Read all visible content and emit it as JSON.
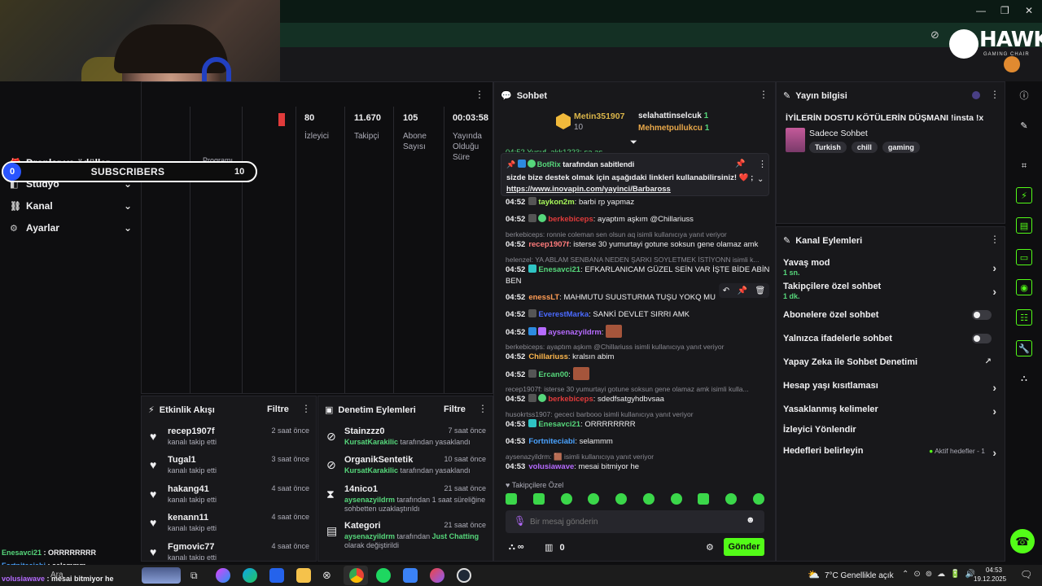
{
  "overlay": {
    "subscribers_current": "0",
    "subscribers_label": "SUBSCRIBERS",
    "subscribers_goal": "10",
    "brand_name": "HAWK",
    "brand_tagline": "GAMING CHAIR",
    "chat_overlay": [
      {
        "user": "Enesavci21",
        "msg": " : ORRRRRRRR",
        "color": "#56d77b"
      },
      {
        "user": "Fortniteciabi",
        "msg": " : selammm",
        "color": "#4aa3ff"
      },
      {
        "user": "volusiawave",
        "msg": " : mesai bitmiyor he",
        "color": "#b66bff"
      }
    ]
  },
  "leftnav": {
    "items": [
      {
        "label": "Droplar ve ödüller",
        "icon": "gift-icon"
      },
      {
        "label": "Stüdyo",
        "icon": "studio-icon"
      },
      {
        "label": "Kanal",
        "icon": "channel-icon"
      },
      {
        "label": "Ayarlar",
        "icon": "gear-icon"
      }
    ],
    "program_label": "Programı"
  },
  "stats": {
    "items": [
      {
        "value": "80",
        "label": "İzleyici"
      },
      {
        "value": "11.670",
        "label": "Takipçi"
      },
      {
        "value": "105",
        "label": "Abone Sayısı"
      },
      {
        "value": "00:03:58",
        "label": "Yayında Olduğu Süre"
      }
    ]
  },
  "activity": {
    "title": "Etkinlik Akışı",
    "filter": "Filtre",
    "rows": [
      {
        "name": "recep1907f",
        "sub": "kanalı takip etti",
        "time": "2 saat önce"
      },
      {
        "name": "Tugal1",
        "sub": "kanalı takip etti",
        "time": "3 saat önce"
      },
      {
        "name": "hakang41",
        "sub": "kanalı takip etti",
        "time": "4 saat önce"
      },
      {
        "name": "kenann11",
        "sub": "kanalı takip etti",
        "time": "4 saat önce"
      },
      {
        "name": "Fgmovic77",
        "sub": "kanalı takip etti",
        "time": "4 saat önce"
      }
    ]
  },
  "moderation": {
    "title": "Denetim Eylemleri",
    "filter": "Filtre",
    "rows": [
      {
        "name": "Stainzzz0",
        "actor": "KursatKarakilic",
        "action": " tarafından yasaklandı",
        "extra": "",
        "time": "7 saat önce"
      },
      {
        "name": "OrganikSentetik",
        "actor": "KursatKarakilic",
        "action": " tarafından yasaklandı",
        "extra": "",
        "time": "10 saat önce"
      },
      {
        "name": "14nico1",
        "actor": "aysenazyildrm",
        "action": " tarafından 1 saat süreliğine",
        "extra": "sohbetten uzaklaştırıldı",
        "time": "21 saat önce"
      },
      {
        "name": "Kategori",
        "actor": "aysenazyildrm",
        "action": " tarafından ",
        "actor2": "Just Chatting",
        "extra": "olarak değiştirildi",
        "time": "21 saat önce"
      }
    ]
  },
  "chat": {
    "title": "Sohbet",
    "leaders": [
      {
        "name": "Metin351907",
        "count": "10"
      },
      {
        "name": "selahattinselcuk",
        "count": "1"
      },
      {
        "name": "Mehmetpullukcu",
        "count": "1"
      }
    ],
    "pinned": {
      "bot": "BotRix",
      "header": " tarafından sabitlendi",
      "text": "sizde bize destek olmak için aşağıdaki linkleri kullanabilirsiniz! ❤️ ;",
      "link": "https://www.inovapin.com/yayinci/Barbaross"
    },
    "truncated_top": "04:52 Yusuf_akk1223: sa as",
    "messages": [
      {
        "type": "msg",
        "time": "04:52",
        "user": "taykon2m",
        "color": "#a7f85a",
        "text": "barbi rp yapmaz"
      },
      {
        "type": "msg",
        "time": "04:52",
        "user": "berkebiceps",
        "color": "#e13b3b",
        "text": "ayaptım aşkım @Chillariuss"
      },
      {
        "type": "reply",
        "text": "berkebiceps: ronnie coleman sen olsun aq isimli kullanıcıya yanıt veriyor"
      },
      {
        "type": "msg",
        "time": "04:52",
        "user": "recep1907f",
        "color": "#ff7b7b",
        "text": "isterse 30 yumurtayi gotune soksun gene olamaz amk"
      },
      {
        "type": "reply",
        "text": "helenzel: YA ABLAM SENBANA NEDEN ŞARKI SOYLETMEK İSTİYONN isimli k..."
      },
      {
        "type": "msg2",
        "time": "04:52",
        "user": "Enesavci21",
        "color": "#56d77b",
        "text": "EFKARLANICAM GÜZEL SEİN VAR İŞTE BİDE ABİNİM",
        "text2": "BEN"
      },
      {
        "type": "msg",
        "time": "04:52",
        "user": "enessLT",
        "color": "#ff9c54",
        "text": "MAHMUTU SUUSTURMA TUŞU YOKQ MU"
      },
      {
        "type": "msg",
        "time": "04:52",
        "user": "EverestMarka",
        "color": "#4a6aff",
        "text": "SANKİ DEVLET SIRRI AMK"
      },
      {
        "type": "emote",
        "time": "04:52",
        "user": "aysenazyildrm",
        "color": "#b66bff"
      },
      {
        "type": "reply",
        "text": "berkebiceps: ayaptım aşkım @Chillariuss isimli kullanıcıya yanıt veriyor"
      },
      {
        "type": "msg",
        "time": "04:52",
        "user": "Chillariuss",
        "color": "#ffb84d",
        "text": "kralsın abim"
      },
      {
        "type": "emote",
        "time": "04:52",
        "user": "Ercan00",
        "color": "#56d77b"
      },
      {
        "type": "reply",
        "text": "recep1907f: isterse 30 yumurtayi gotune soksun gene olamaz amk isimli kulla..."
      },
      {
        "type": "msg",
        "time": "04:52",
        "user": "berkebiceps",
        "color": "#e13b3b",
        "text": "sdedfsatgyhdbvsaa"
      },
      {
        "type": "reply",
        "text": "husokrtss1907: gececi barbooo isimli kullanıcıya yanıt veriyor"
      },
      {
        "type": "msg",
        "time": "04:53",
        "user": "Enesavci21",
        "color": "#56d77b",
        "text": "ORRRRRRRR"
      },
      {
        "type": "msg",
        "time": "04:53",
        "user": "Fortniteciabi",
        "color": "#4aa3ff",
        "text": "selammm"
      },
      {
        "type": "reply",
        "text": "aysenazyildrm: 🟫 isimli kullanıcıya yanıt veriyor"
      },
      {
        "type": "msg",
        "time": "04:53",
        "user": "volusiawave",
        "color": "#b66bff",
        "text": "mesai bitmiyor he"
      }
    ],
    "followers_only_label": "Takipçilere Özel",
    "input_placeholder": "Bir mesaj gönderin",
    "points": "0",
    "infinity": "∞",
    "send_label": "Gönder"
  },
  "stream_info": {
    "title": "Yayın bilgisi",
    "stream_title": "İYİLERİN DOSTU KÖTÜLERİN DÜŞMANI !insta !x",
    "category": "Sadece Sohbet",
    "tags": [
      "Turkish",
      "chill",
      "gaming"
    ]
  },
  "channel_actions": {
    "title": "Kanal Eylemleri",
    "slow_mode": "Yavaş mod",
    "slow_mode_val": "1 sn.",
    "followers_chat": "Takipçilere özel sohbet",
    "followers_chat_val": "1 dk.",
    "subs_chat": "Abonelere özel sohbet",
    "emote_chat": "Yalnızca ifadelerle sohbet",
    "ai_mod": "Yapay Zeka ile Sohbet Denetimi",
    "age_restrict": "Hesap yaşı kısıtlaması",
    "banned_words": "Yasaklanmış kelimeler",
    "viewer_redirect": "İzleyici Yönlendir",
    "goals": "Hedefleri belirleyin",
    "goals_active": "Aktif hedefler - 1"
  },
  "taskbar": {
    "search": "Ara",
    "weather": "7°C  Genellikle açık",
    "time": "04:53",
    "date": "19.12.2025"
  }
}
